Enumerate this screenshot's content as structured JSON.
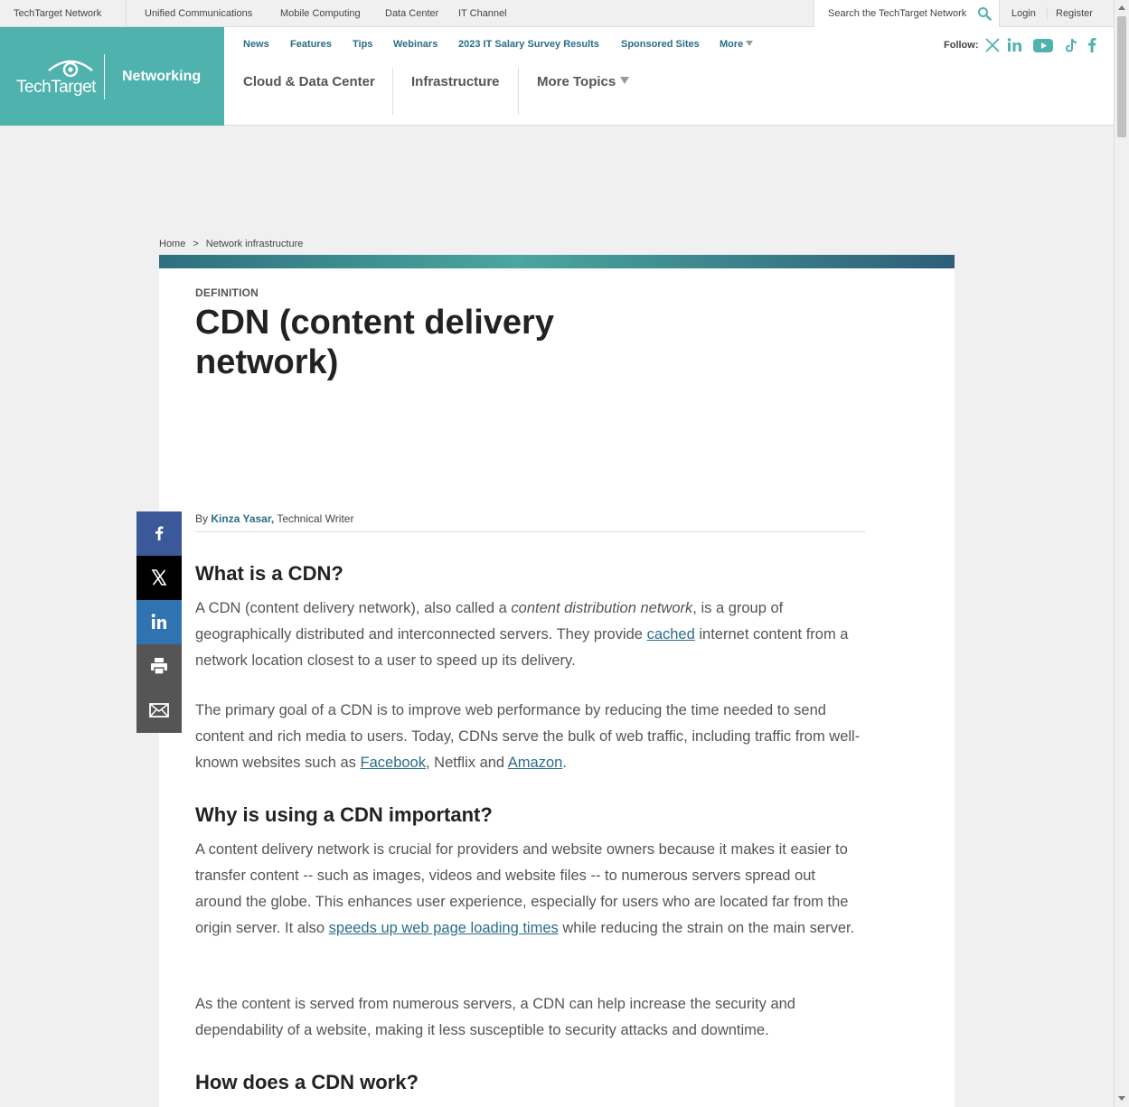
{
  "network_bar": {
    "brand": "TechTarget Network",
    "links": [
      "Unified Communications",
      "Mobile Computing",
      "Data Center",
      "IT Channel"
    ],
    "search_placeholder": "Search the TechTarget Network",
    "login": "Login",
    "register": "Register"
  },
  "header": {
    "logo_text": "TechTarget",
    "site_name": "Networking",
    "subnav": [
      "News",
      "Features",
      "Tips",
      "Webinars",
      "2023 IT Salary Survey Results",
      "Sponsored Sites",
      "More"
    ],
    "mainnav": [
      "Cloud & Data Center",
      "Infrastructure",
      "More Topics"
    ],
    "follow_label": "Follow:",
    "social_icons": [
      "x-icon",
      "linkedin-icon",
      "youtube-icon",
      "tiktok-icon",
      "facebook-icon"
    ]
  },
  "breadcrumb": {
    "home": "Home",
    "separator": ">",
    "current": "Network infrastructure"
  },
  "article": {
    "kicker": "DEFINITION",
    "title": "CDN (content delivery network)",
    "byline_prefix": "By",
    "author": "Kinza Yasar,",
    "author_role": "Technical Writer",
    "sections": {
      "s1_heading": "What is a CDN?",
      "p1_a": "A CDN (content delivery network), also called a ",
      "p1_em": "content distribution network",
      "p1_b": ", is a group of geographically distributed and interconnected servers. They provide ",
      "p1_link": "cached",
      "p1_c": " internet content from a network location closest to a user to speed up its delivery.",
      "p2_a": "The primary goal of a CDN is to improve web performance by reducing the time needed to send content and rich media to users. Today, CDNs serve the bulk of web traffic, including traffic from well-known websites such as ",
      "p2_link1": "Facebook",
      "p2_b": ", Netflix and ",
      "p2_link2": "Amazon",
      "p2_c": ".",
      "s2_heading": "Why is using a CDN important?",
      "p3_a": "A content delivery network is crucial for providers and website owners because it makes it easier to transfer content -- such as images, videos and website files -- to numerous servers spread out around the globe. This enhances user experience, especially for users who are located far from the origin server. It also ",
      "p3_link": "speeds up web page loading times",
      "p3_b": " while reducing the strain on the main server.",
      "p4": "As the content is served from numerous servers, a CDN can help increase the security and dependability of a website, making it less susceptible to security attacks and downtime.",
      "s3_heading": "How does a CDN work?"
    }
  },
  "share_rail": {
    "items": [
      "facebook-share",
      "x-share",
      "linkedin-share",
      "print",
      "email"
    ],
    "colors": [
      "#3b5998",
      "#000000",
      "#2f73b0",
      "#555555",
      "#555555"
    ]
  },
  "colors": {
    "brand_teal": "#4fb2ad",
    "link_blue": "#2a6d8a"
  }
}
